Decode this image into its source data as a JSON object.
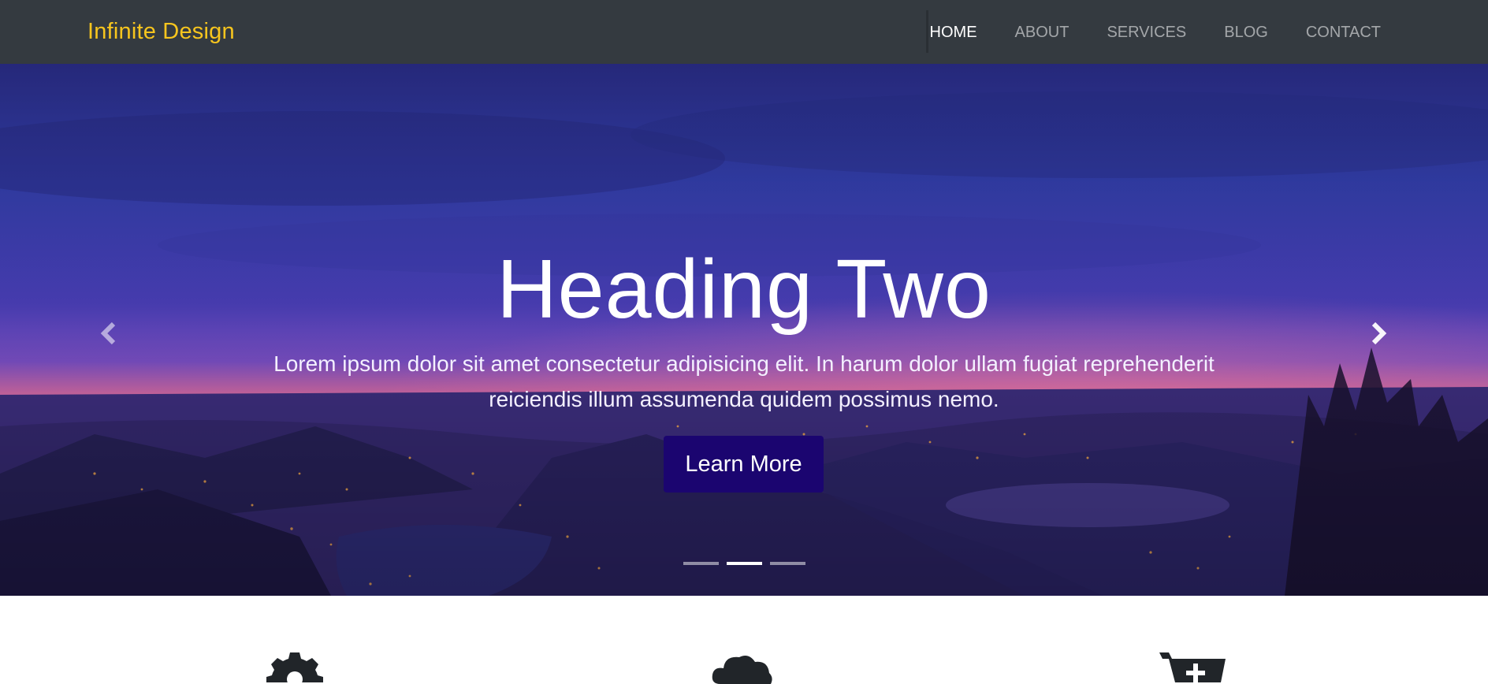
{
  "navbar": {
    "brand": "Infinite Design",
    "items": [
      {
        "label": "HOME",
        "active": true
      },
      {
        "label": "ABOUT",
        "active": false
      },
      {
        "label": "SERVICES",
        "active": false
      },
      {
        "label": "BLOG",
        "active": false
      },
      {
        "label": "CONTACT",
        "active": false
      }
    ]
  },
  "hero": {
    "title": "Heading Two",
    "text_line1": "Lorem ipsum dolor sit amet consectetur adipisicing elit. In harum dolor ullam fugiat reprehenderit",
    "text_line2": "reiciendis illum assumenda quidem possimus nemo.",
    "button_label": "Learn More",
    "prev_icon": "chevron-left-icon",
    "next_icon": "chevron-right-icon",
    "slide_count": 3,
    "active_slide": 2
  },
  "features": {
    "icons": [
      "gear-icon",
      "cloud-icon",
      "cart-plus-icon"
    ]
  },
  "colors": {
    "navbar_bg": "#343a40",
    "brand": "#f7c51e",
    "button_bg": "#1b0570"
  }
}
